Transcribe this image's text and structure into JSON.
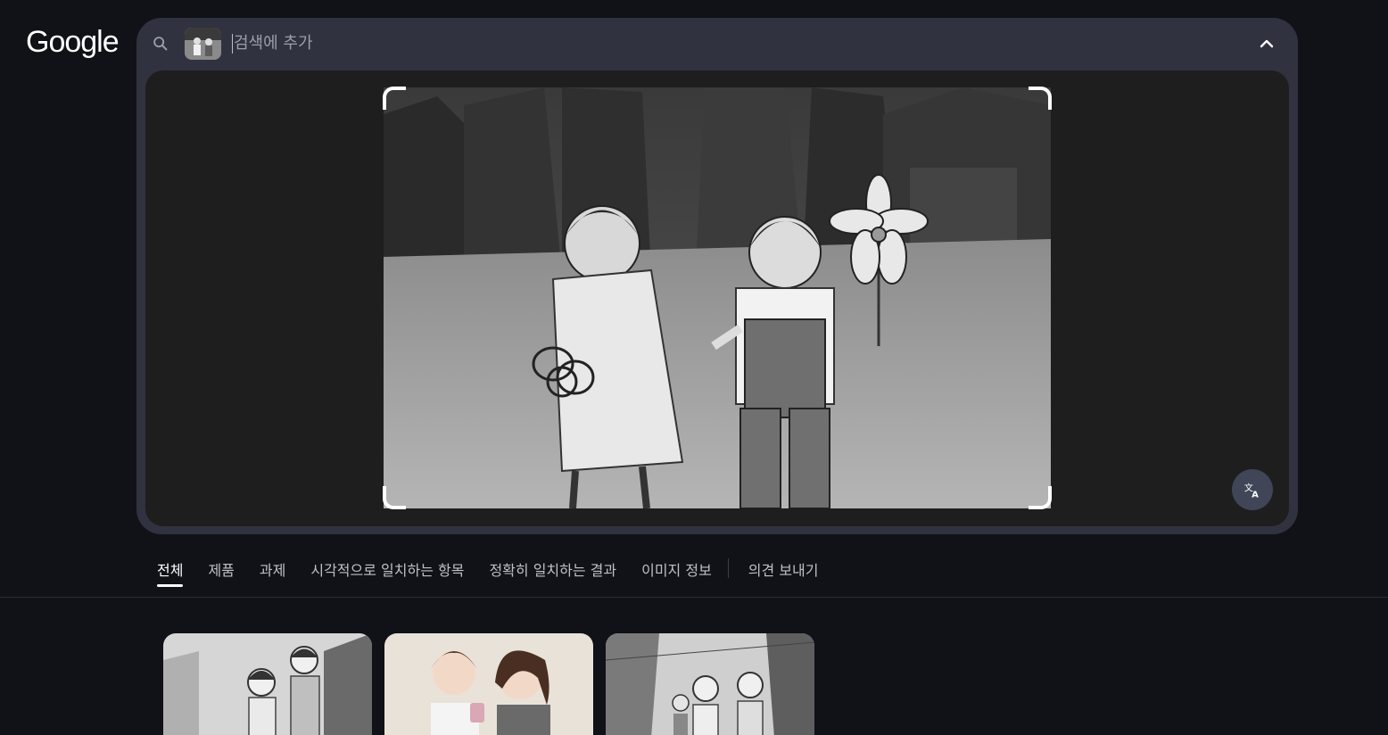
{
  "brand": {
    "logo_text": "Google"
  },
  "search": {
    "placeholder": "검색에 추가",
    "value": ""
  },
  "icons": {
    "search": "search-icon",
    "collapse": "chevron-up-icon",
    "translate": "translate-icon"
  },
  "tabs": [
    {
      "label": "전체",
      "active": true
    },
    {
      "label": "제품",
      "active": false
    },
    {
      "label": "과제",
      "active": false
    },
    {
      "label": "시각적으로 일치하는 항목",
      "active": false
    },
    {
      "label": "정확히 일치하는 결과",
      "active": false
    },
    {
      "label": "이미지 정보",
      "active": false
    },
    {
      "label": "의견 보내기",
      "active": false
    }
  ],
  "colors": {
    "page_bg": "#101218",
    "panel_bg": "#303240",
    "stage_bg": "#1e1e1e",
    "active_tab": "#ffffff"
  }
}
